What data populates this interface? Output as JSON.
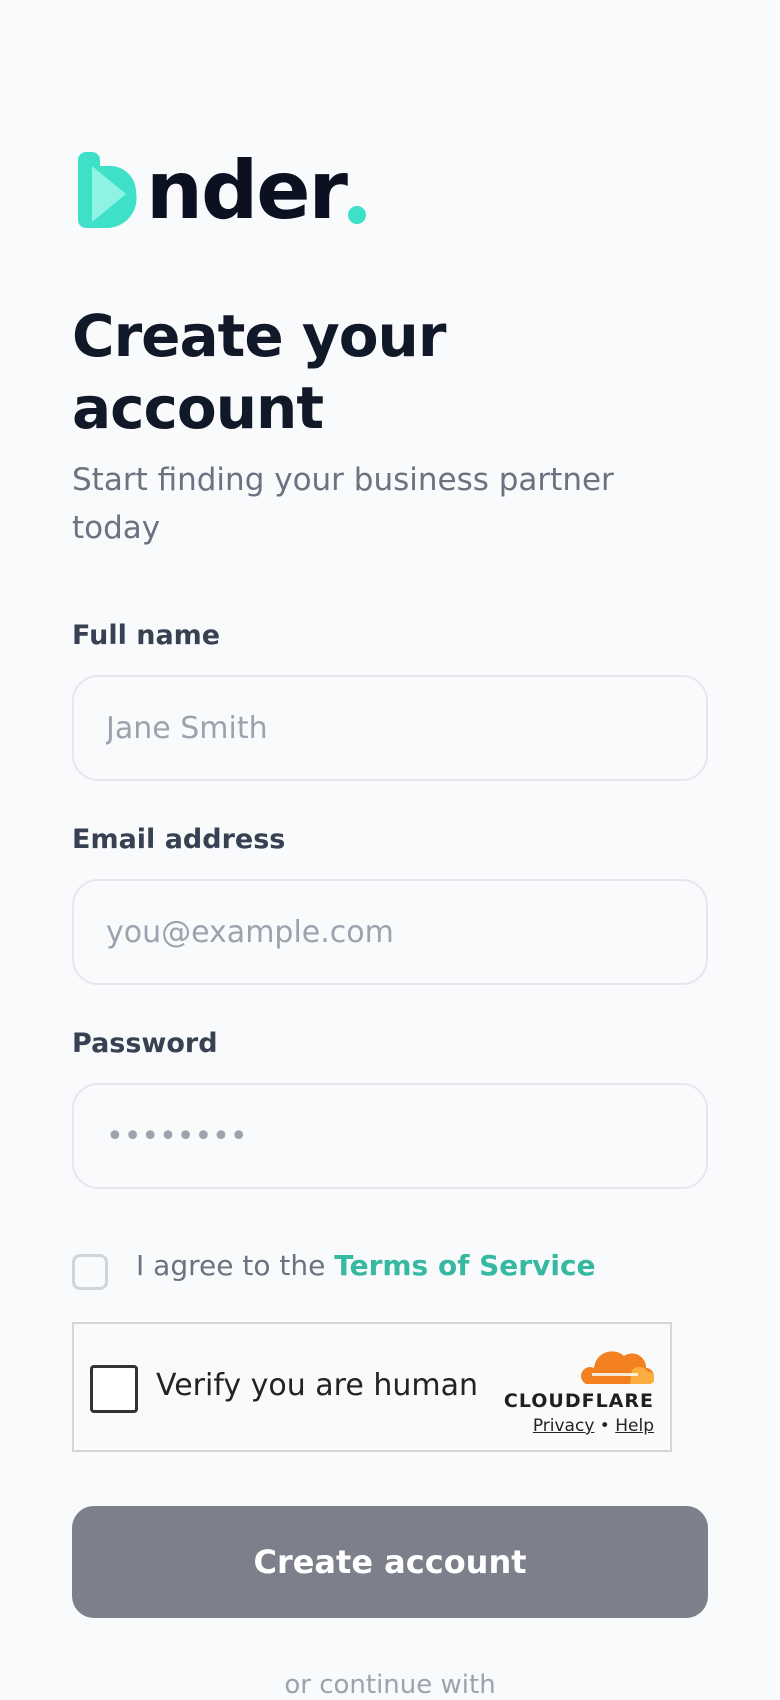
{
  "brand": {
    "name_text": "nder",
    "accent_color": "#3ee0c8",
    "accent_light": "#7ef0df"
  },
  "header": {
    "title": "Create your account",
    "subtitle": "Start finding your business partner today"
  },
  "form": {
    "full_name": {
      "label": "Full name",
      "placeholder": "Jane Smith",
      "value": ""
    },
    "email": {
      "label": "Email address",
      "placeholder": "you@example.com",
      "value": ""
    },
    "password": {
      "label": "Password",
      "placeholder": "••••••••",
      "value": ""
    },
    "terms": {
      "prefix": "I agree to the ",
      "link_label": "Terms of Service",
      "link_color": "#36b9a0",
      "checked": false
    },
    "captcha": {
      "label": "Verify you are human",
      "provider": "CLOUDFLARE",
      "privacy_label": "Privacy",
      "separator": "•",
      "help_label": "Help",
      "cloud_icon": "cloudflare-cloud-icon",
      "cloud_color": "#f38020"
    },
    "submit_label": "Create account",
    "submit_color": "#7d808b"
  },
  "footer": {
    "divider_text": "or continue with"
  }
}
